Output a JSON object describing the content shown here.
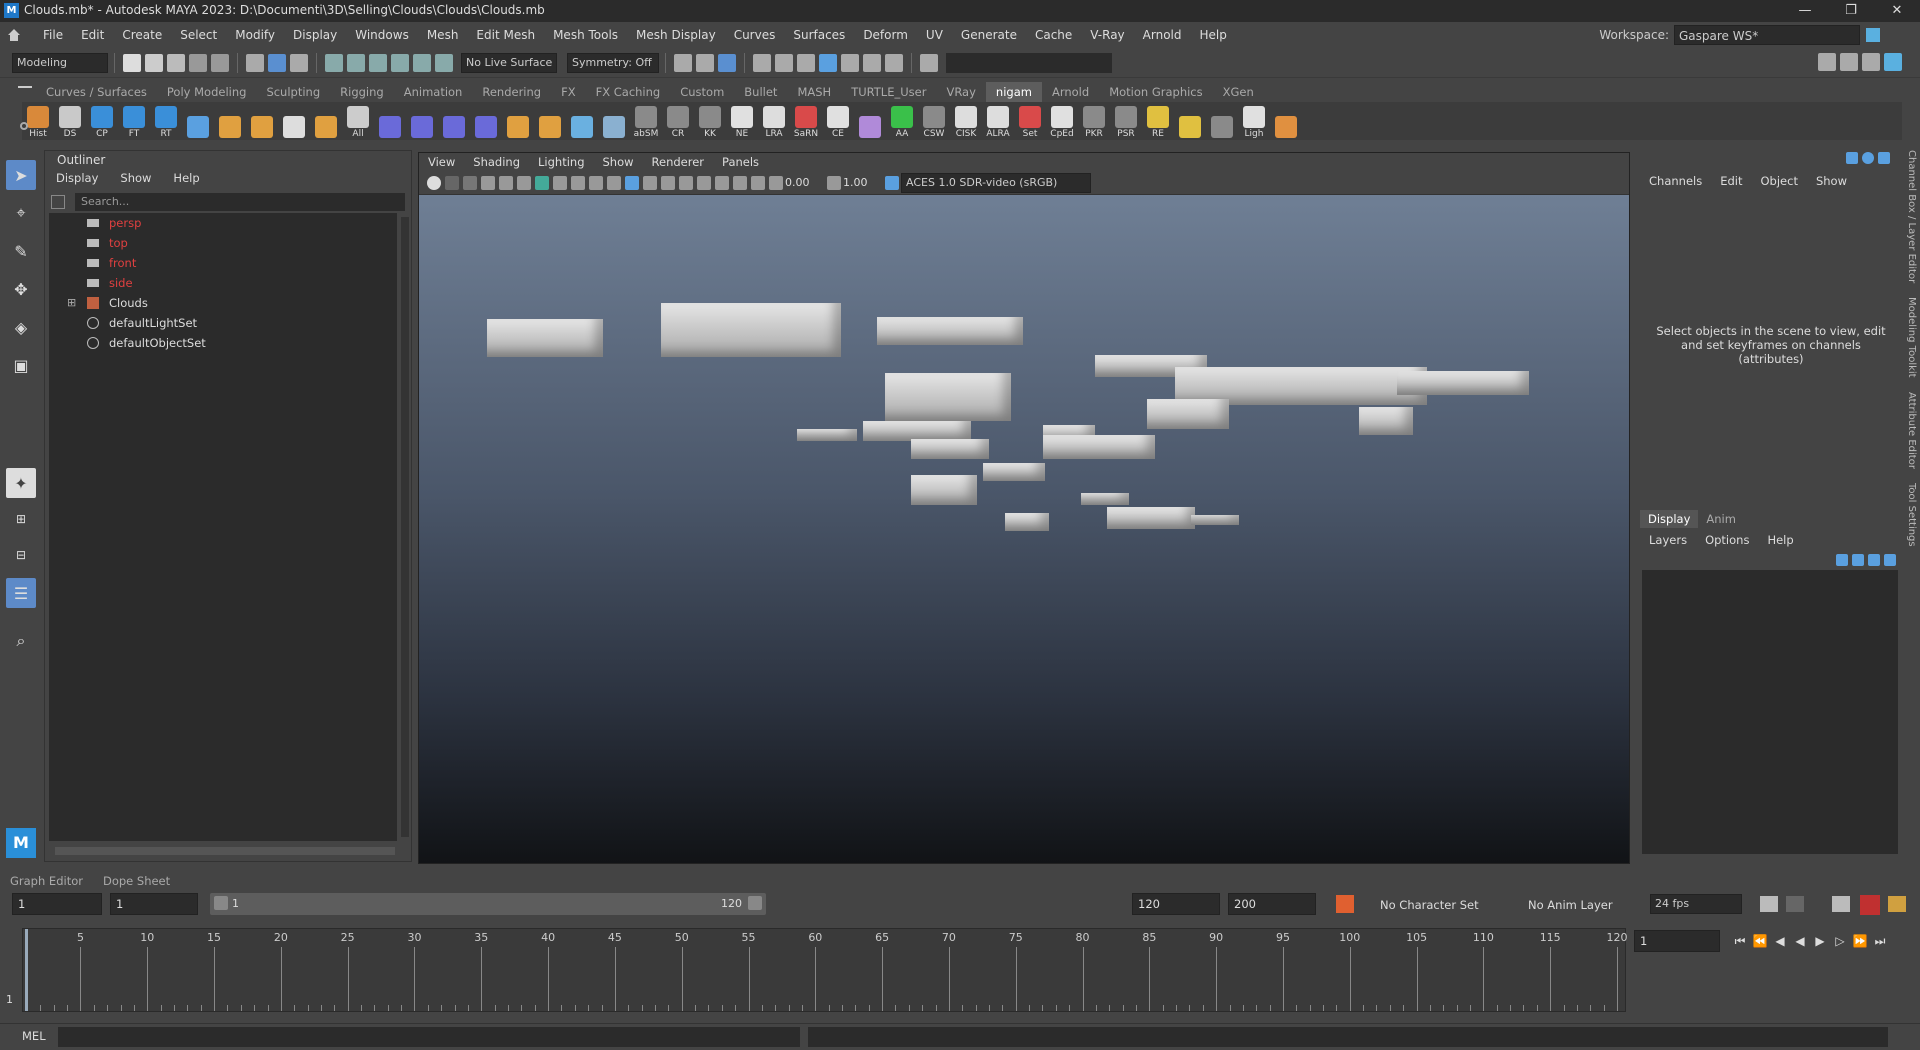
{
  "titlebar": {
    "logo": "M",
    "title": "Clouds.mb* - Autodesk MAYA 2023: D:\\Documenti\\3D\\Selling\\Clouds\\Clouds\\Clouds.mb",
    "minimize": "—",
    "maximize": "❐",
    "close": "✕"
  },
  "menu": [
    "File",
    "Edit",
    "Create",
    "Select",
    "Modify",
    "Display",
    "Windows",
    "Mesh",
    "Edit Mesh",
    "Mesh Tools",
    "Mesh Display",
    "Curves",
    "Surfaces",
    "Deform",
    "UV",
    "Generate",
    "Cache",
    "V-Ray",
    "Arnold",
    "Help"
  ],
  "workspace": {
    "label": "Workspace:",
    "value": "Gaspare WS*"
  },
  "statusline": {
    "mode": "Modeling",
    "live_surface": "No Live Surface",
    "symmetry": "Symmetry: Off"
  },
  "shelf_tabs": [
    "Curves / Surfaces",
    "Poly Modeling",
    "Sculpting",
    "Rigging",
    "Animation",
    "Rendering",
    "FX",
    "FX Caching",
    "Custom",
    "Bullet",
    "MASH",
    "TURTLE_User",
    "VRay",
    "nigam",
    "Arnold",
    "Motion Graphics",
    "XGen"
  ],
  "shelf_active_tab": "nigam",
  "shelf_icons": [
    {
      "label": "Hist",
      "color": "#d9893a"
    },
    {
      "label": "DS",
      "color": "#c9c9c9"
    },
    {
      "label": "CP",
      "color": "#3a8fd9"
    },
    {
      "label": "FT",
      "color": "#3a8fd9"
    },
    {
      "label": "RT",
      "color": "#3a8fd9"
    },
    {
      "label": "",
      "color": "#5aa0e0"
    },
    {
      "label": "",
      "color": "#e0a040"
    },
    {
      "label": "",
      "color": "#e0a040"
    },
    {
      "label": "",
      "color": "#dddddd"
    },
    {
      "label": "",
      "color": "#e0a040"
    },
    {
      "label": "All",
      "color": "#cccccc"
    },
    {
      "label": "",
      "color": "#6a6ad9"
    },
    {
      "label": "",
      "color": "#6a6ad9"
    },
    {
      "label": "",
      "color": "#6a6ad9"
    },
    {
      "label": "",
      "color": "#6a6ad9"
    },
    {
      "label": "",
      "color": "#e0a040"
    },
    {
      "label": "",
      "color": "#e0a040"
    },
    {
      "label": "",
      "color": "#6ab0e0"
    },
    {
      "label": "",
      "color": "#8ab0d0"
    },
    {
      "label": "abSM",
      "color": "#8a8a8a"
    },
    {
      "label": "CR",
      "color": "#8a8a8a"
    },
    {
      "label": "KK",
      "color": "#8a8a8a"
    },
    {
      "label": "NE",
      "color": "#e0e0e0"
    },
    {
      "label": "LRA",
      "color": "#dddddd"
    },
    {
      "label": "SaRN",
      "color": "#d94a4a"
    },
    {
      "label": "CE",
      "color": "#e0e0e0"
    },
    {
      "label": "",
      "color": "#b08ad9"
    },
    {
      "label": "AA",
      "color": "#3ac04a"
    },
    {
      "label": "CSW",
      "color": "#8a8a8a"
    },
    {
      "label": "CISK",
      "color": "#dddddd"
    },
    {
      "label": "ALRA",
      "color": "#dddddd"
    },
    {
      "label": "Set",
      "color": "#d94a4a"
    },
    {
      "label": "CpEd",
      "color": "#e0e0e0"
    },
    {
      "label": "PKR",
      "color": "#8a8a8a"
    },
    {
      "label": "PSR",
      "color": "#8a8a8a"
    },
    {
      "label": "RE",
      "color": "#e0c040"
    },
    {
      "label": "",
      "color": "#e0c040"
    },
    {
      "label": "",
      "color": "#8a8a8a"
    },
    {
      "label": "Ligh",
      "color": "#e0e0e0"
    },
    {
      "label": "",
      "color": "#e09040"
    }
  ],
  "outliner": {
    "title": "Outliner",
    "menu": [
      "Display",
      "Show",
      "Help"
    ],
    "search_placeholder": "Search...",
    "items": [
      {
        "name": "persp",
        "type": "camera"
      },
      {
        "name": "top",
        "type": "camera"
      },
      {
        "name": "front",
        "type": "camera"
      },
      {
        "name": "side",
        "type": "camera"
      },
      {
        "name": "Clouds",
        "type": "group"
      },
      {
        "name": "defaultLightSet",
        "type": "set"
      },
      {
        "name": "defaultObjectSet",
        "type": "set"
      }
    ]
  },
  "viewport": {
    "menu": [
      "View",
      "Shading",
      "Lighting",
      "Show",
      "Renderer",
      "Panels"
    ],
    "exposure": "0.00",
    "gamma": "1.00",
    "colorspace": "ACES 1.0 SDR-video (sRGB)"
  },
  "channelbox": {
    "menu": [
      "Channels",
      "Edit",
      "Object",
      "Show"
    ],
    "empty_text": "Select objects in the scene to view, edit and set keyframes on channels (attributes)",
    "layer_tabs": [
      "Display",
      "Anim"
    ],
    "layer_menu": [
      "Layers",
      "Options",
      "Help"
    ]
  },
  "side_tabs": [
    "Channel Box / Layer Editor",
    "Modeling Toolkit",
    "Attribute Editor",
    "Tool Settings"
  ],
  "bottom_tabs": [
    "Graph Editor",
    "Dope Sheet"
  ],
  "range": {
    "start": "1",
    "current_start": "1",
    "slider_start": "1",
    "slider_end": "120",
    "end": "120",
    "max_end": "200",
    "character_set": "No Character Set",
    "anim_layer": "No Anim Layer",
    "fps": "24 fps"
  },
  "timeline": {
    "labels": [
      "5",
      "10",
      "15",
      "20",
      "25",
      "30",
      "35",
      "40",
      "45",
      "50",
      "55",
      "60",
      "65",
      "70",
      "75",
      "80",
      "85",
      "90",
      "95",
      "100",
      "105",
      "110",
      "115",
      "120"
    ],
    "current_frame": "1",
    "min": 1,
    "max": 120
  },
  "current_frame_field": "1",
  "cmdline": {
    "label": "MEL"
  }
}
